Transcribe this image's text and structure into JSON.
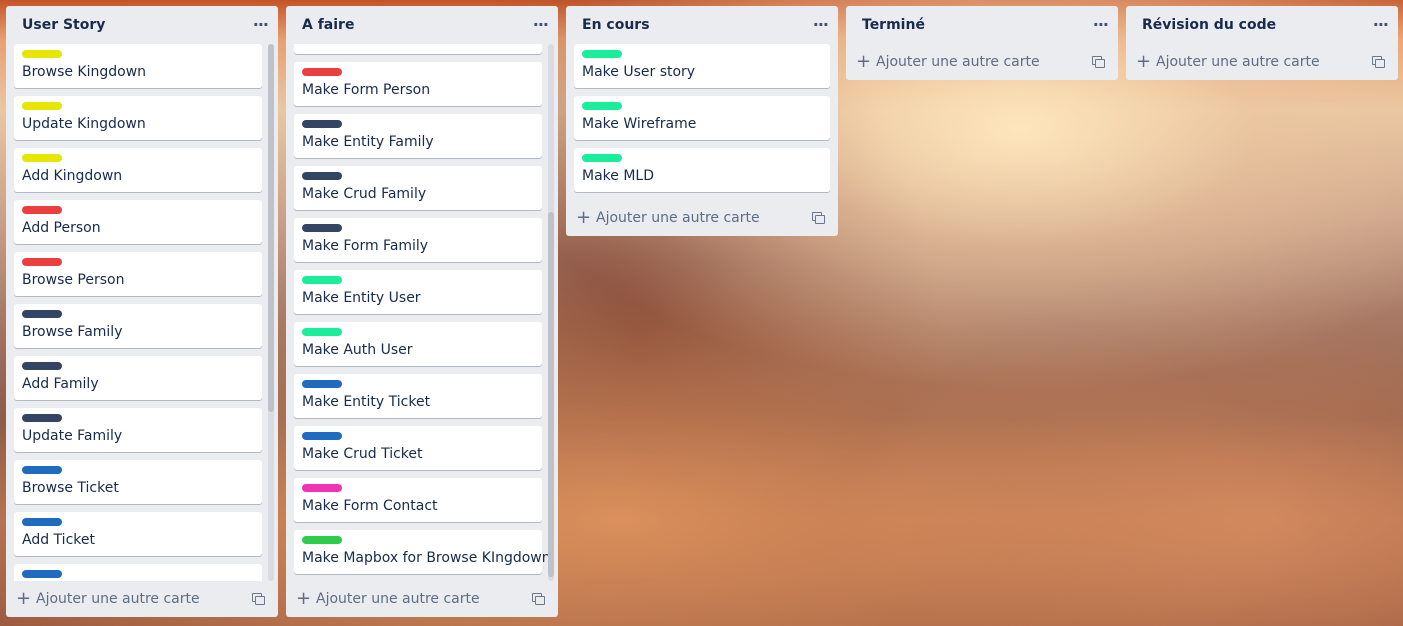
{
  "colors": {
    "yellow": "#e6e600",
    "red": "#eb3f3f",
    "navy": "#344563",
    "green": "#1aee9a",
    "blue": "#1f6bbf",
    "pink": "#f032b4",
    "lime": "#2ecc4a"
  },
  "common": {
    "add_card": "Ajouter une autre carte",
    "add_icon": "plus-icon",
    "menu_icon": "more-icon",
    "template_icon": "card-template-icon"
  },
  "lists": [
    {
      "title": "User Story",
      "cards": [
        {
          "label": "yellow",
          "title": "Browse Kingdown"
        },
        {
          "label": "yellow",
          "title": "Update Kingdown"
        },
        {
          "label": "yellow",
          "title": "Add Kingdown"
        },
        {
          "label": "red",
          "title": "Add Person"
        },
        {
          "label": "red",
          "title": "Browse Person"
        },
        {
          "label": "navy",
          "title": "Browse Family"
        },
        {
          "label": "navy",
          "title": "Add Family"
        },
        {
          "label": "navy",
          "title": "Update Family"
        },
        {
          "label": "blue",
          "title": "Browse Ticket"
        },
        {
          "label": "blue",
          "title": "Add Ticket"
        },
        {
          "label": "blue",
          "title": ""
        }
      ]
    },
    {
      "title": "A faire",
      "cards": [
        {
          "label": "red",
          "title": "Make Form Person"
        },
        {
          "label": "navy",
          "title": "Make Entity Family"
        },
        {
          "label": "navy",
          "title": "Make Crud Family"
        },
        {
          "label": "navy",
          "title": "Make Form Family"
        },
        {
          "label": "green",
          "title": "Make Entity User"
        },
        {
          "label": "green",
          "title": "Make Auth User"
        },
        {
          "label": "blue",
          "title": "Make Entity Ticket"
        },
        {
          "label": "blue",
          "title": "Make Crud Ticket"
        },
        {
          "label": "pink",
          "title": "Make Form Contact"
        },
        {
          "label": "lime",
          "title": "Make Mapbox for Browse KIngdown"
        }
      ]
    },
    {
      "title": "En cours",
      "cards": [
        {
          "label": "green",
          "title": "Make User story"
        },
        {
          "label": "green",
          "title": "Make Wireframe"
        },
        {
          "label": "green",
          "title": "Make MLD"
        }
      ]
    },
    {
      "title": "Terminé",
      "cards": []
    },
    {
      "title": "Révision du code",
      "cards": []
    }
  ]
}
